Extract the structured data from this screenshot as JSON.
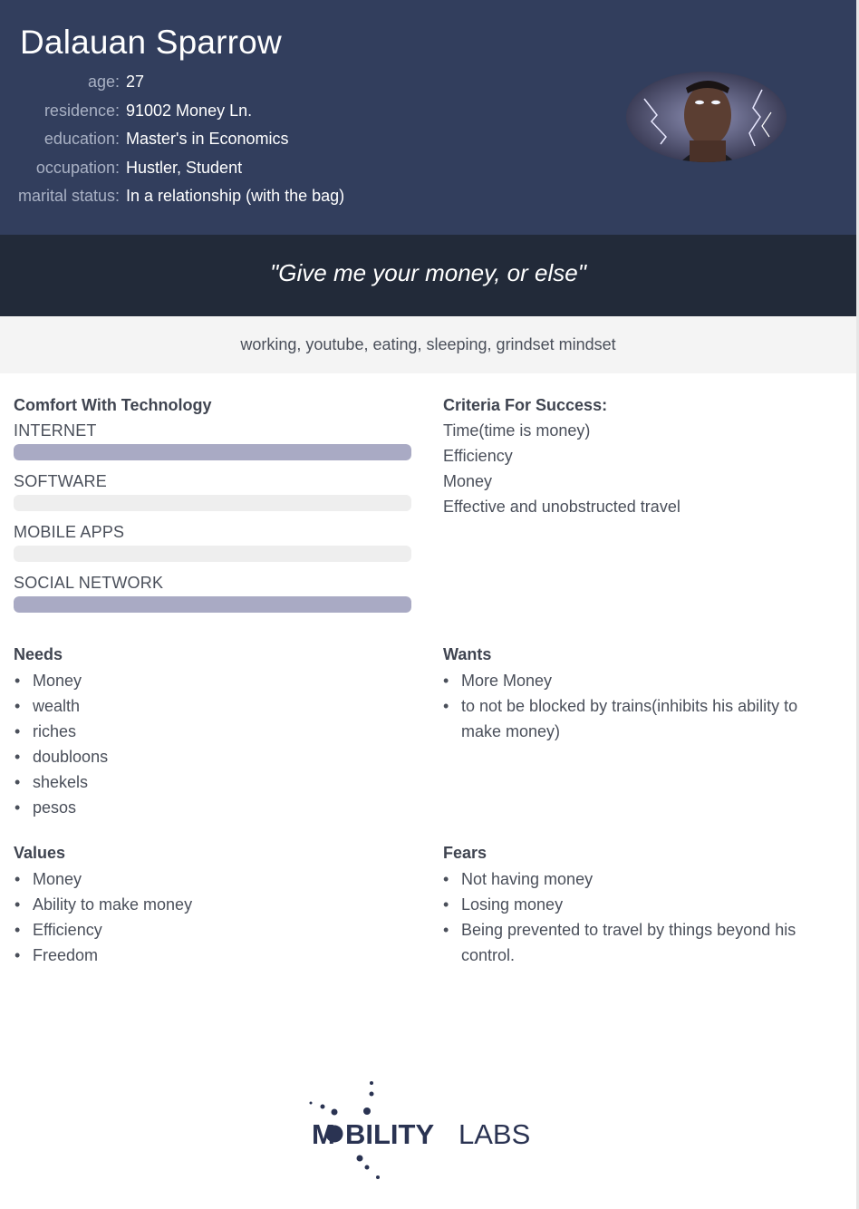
{
  "persona": {
    "name": "Dalauan Sparrow",
    "facts": [
      {
        "label": "age:",
        "value": "27"
      },
      {
        "label": "residence:",
        "value": "91002 Money Ln."
      },
      {
        "label": "education:",
        "value": "Master's in Economics"
      },
      {
        "label": "occupation:",
        "value": "Hustler, Student"
      },
      {
        "label": "marital status:",
        "value": "In a relationship (with the bag)"
      }
    ],
    "quote": "\"Give me your money, or else\"",
    "hobbies": "working, youtube, eating, sleeping, grindset mindset"
  },
  "tech": {
    "title": "Comfort With Technology",
    "items": [
      {
        "label": "INTERNET",
        "level": 1.0
      },
      {
        "label": "SOFTWARE",
        "level": 0.0
      },
      {
        "label": "MOBILE APPS",
        "level": 0.0
      },
      {
        "label": "SOCIAL NETWORK",
        "level": 1.0
      }
    ]
  },
  "criteria": {
    "title": "Criteria For Success:",
    "items": [
      "Time(time is money)",
      "Efficiency",
      "Money",
      "Effective and unobstructed travel"
    ]
  },
  "needs": {
    "title": "Needs",
    "items": [
      "Money",
      "wealth",
      "riches",
      "doubloons",
      "shekels",
      "pesos"
    ]
  },
  "wants": {
    "title": "Wants",
    "items": [
      "More Money",
      "to not be blocked by trains(inhibits his ability to make money)"
    ]
  },
  "values": {
    "title": "Values",
    "items": [
      "Money",
      "Ability to make money",
      "Efficiency",
      "Freedom"
    ]
  },
  "fears": {
    "title": "Fears",
    "items": [
      "Not having money",
      "Losing money",
      "Being prevented to travel by things beyond his control."
    ]
  },
  "logo": {
    "text_a": "M",
    "text_b": "BILITY",
    "text_c": "LABS"
  },
  "colors": {
    "header": "#323e5d",
    "quote_band": "#222a39",
    "bar_fill": "#a9aac4",
    "bar_track": "#eeeeee"
  }
}
